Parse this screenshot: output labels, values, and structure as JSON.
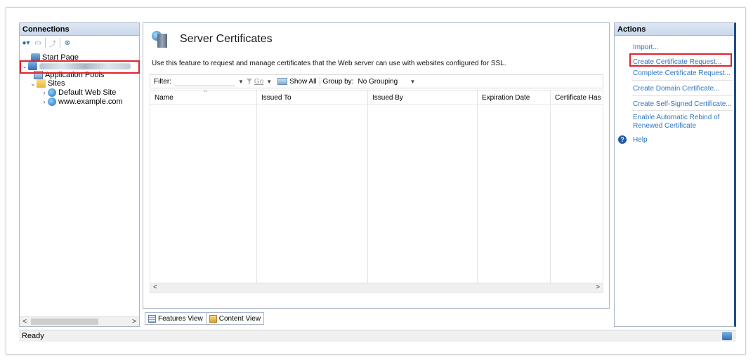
{
  "connections": {
    "title": "Connections",
    "tree": {
      "start_page": "Start Page",
      "application_pools": "Application Pools",
      "sites": "Sites",
      "default_web_site": "Default Web Site",
      "example_site": "www.example.com"
    },
    "scroll_left": "<",
    "scroll_right": ">"
  },
  "center": {
    "title": "Server Certificates",
    "description": "Use this feature to request and manage certificates that the Web server can use with websites configured for SSL.",
    "filter": {
      "label": "Filter:",
      "go": "Go",
      "show_all": "Show All",
      "group_by_label": "Group by:",
      "group_by_value": "No Grouping"
    },
    "columns": [
      "Name",
      "Issued To",
      "Issued By",
      "Expiration Date",
      "Certificate Has"
    ],
    "scroll_left": "<",
    "scroll_right": ">",
    "tabs": {
      "features_view": "Features View",
      "content_view": "Content View"
    }
  },
  "actions": {
    "title": "Actions",
    "items": [
      "Import...",
      "Create Certificate Request...",
      "Complete Certificate Request...",
      "Create Domain Certificate...",
      "Create Self-Signed Certificate...",
      "Enable Automatic Rebind of",
      "Renewed Certificate",
      "Help"
    ]
  },
  "status": {
    "text": "Ready"
  },
  "colors": {
    "link": "#2f74c0",
    "highlight": "#e0222b",
    "pane_border": "#a9b7c9"
  }
}
